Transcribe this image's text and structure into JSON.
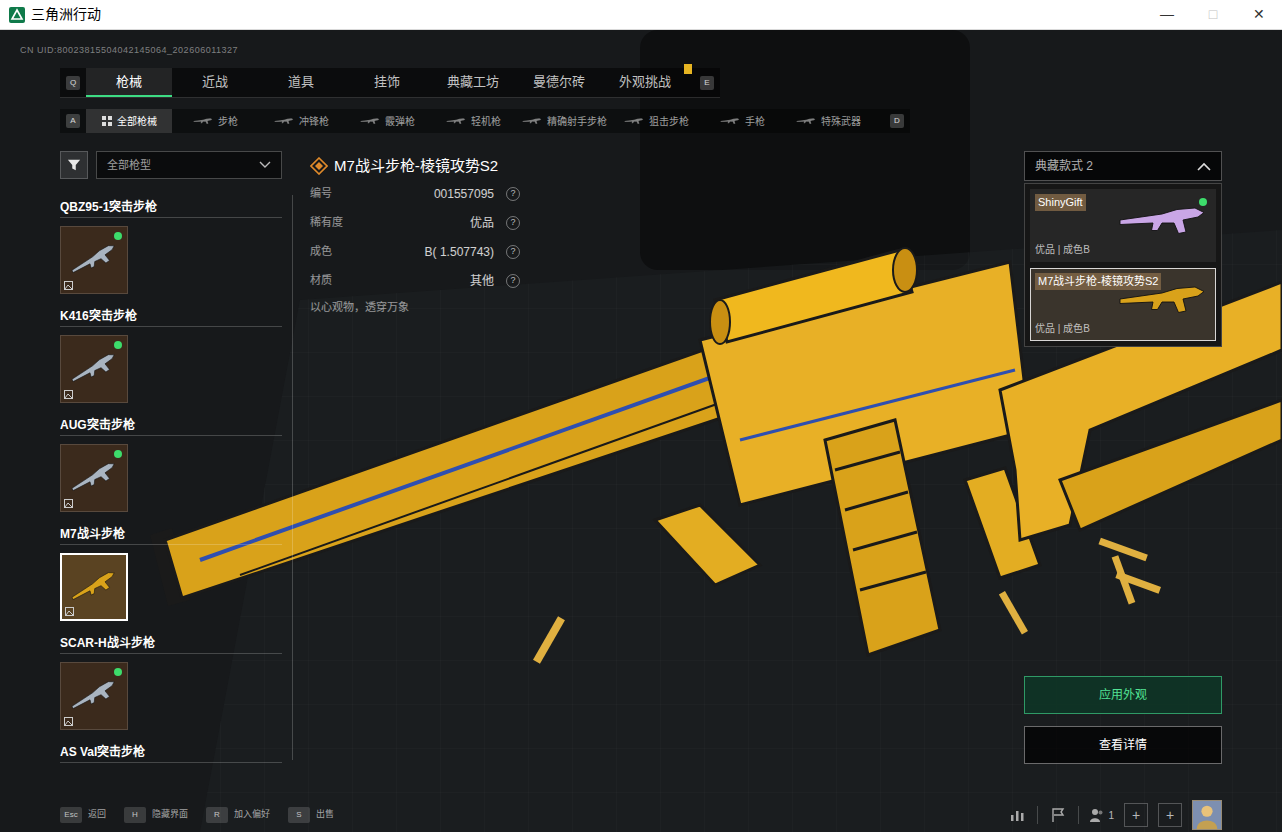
{
  "window": {
    "title": "三角洲行动",
    "controls": [
      {
        "label": "—",
        "disabled": false
      },
      {
        "label": "□",
        "disabled": true
      },
      {
        "label": "✕",
        "disabled": false
      }
    ]
  },
  "uid": "CN UID:80023815504042145064_202606011327",
  "main_tabs": {
    "prev_key": "Q",
    "next_key": "E",
    "items": [
      {
        "label": "枪械",
        "selected": true,
        "notice": false
      },
      {
        "label": "近战",
        "selected": false,
        "notice": false
      },
      {
        "label": "道具",
        "selected": false,
        "notice": false
      },
      {
        "label": "挂饰",
        "selected": false,
        "notice": false
      },
      {
        "label": "典藏工坊",
        "selected": false,
        "notice": false
      },
      {
        "label": "曼德尔砖",
        "selected": false,
        "notice": false
      },
      {
        "label": "外观挑战",
        "selected": false,
        "notice": true
      }
    ]
  },
  "sub_tabs": {
    "prev_key": "A",
    "next_key": "D",
    "items": [
      {
        "label": "全部枪械",
        "selected": true
      },
      {
        "label": "步枪",
        "selected": false
      },
      {
        "label": "冲锋枪",
        "selected": false
      },
      {
        "label": "霰弹枪",
        "selected": false
      },
      {
        "label": "轻机枪",
        "selected": false
      },
      {
        "label": "精确射手步枪",
        "selected": false
      },
      {
        "label": "狙击步枪",
        "selected": false
      },
      {
        "label": "手枪",
        "selected": false
      },
      {
        "label": "特殊武器",
        "selected": false
      }
    ]
  },
  "filter": {
    "value": "全部枪型"
  },
  "weapons": [
    {
      "name": "QBZ95-1突击步枪",
      "equipped": true,
      "selected": false
    },
    {
      "name": "K416突击步枪",
      "equipped": true,
      "selected": false
    },
    {
      "name": "AUG突击步枪",
      "equipped": true,
      "selected": false
    },
    {
      "name": "M7战斗步枪",
      "equipped": false,
      "selected": true
    },
    {
      "name": "SCAR-H战斗步枪",
      "equipped": true,
      "selected": false
    },
    {
      "name": "AS Val突击步枪",
      "equipped": false,
      "selected": false
    }
  ],
  "detail": {
    "title": "M7战斗步枪-棱镜攻势S2",
    "fields": [
      {
        "label": "编号",
        "value": "001557095",
        "help": "?"
      },
      {
        "label": "稀有度",
        "value": "优品",
        "help": "?"
      },
      {
        "label": "成色",
        "value": "B( 1.507743)",
        "help": "?"
      },
      {
        "label": "材质",
        "value": "其他",
        "help": "?"
      }
    ],
    "description": "以心观物，透穿万象"
  },
  "styles": {
    "label": "典藏款式 2",
    "expanded": true,
    "items": [
      {
        "name": "ShinyGift",
        "info": "优品 | 成色B",
        "equipped": true,
        "selected": false,
        "color": "#c9a6e6"
      },
      {
        "name": "M7战斗步枪-棱镜攻势S2",
        "info": "优品 | 成色B",
        "equipped": false,
        "selected": true,
        "color": "#d9a21a"
      }
    ]
  },
  "buttons": [
    {
      "label": "应用外观",
      "kind": "primary"
    },
    {
      "label": "查看详情",
      "kind": "secondary"
    }
  ],
  "footer": {
    "hints": [
      {
        "key": "Esc",
        "label": "返回"
      },
      {
        "key": "H",
        "label": "隐藏界面"
      },
      {
        "key": "R",
        "label": "加入偏好"
      },
      {
        "key": "S",
        "label": "出售"
      }
    ],
    "party_count": "1",
    "add_buttons": [
      "+",
      "+"
    ]
  }
}
